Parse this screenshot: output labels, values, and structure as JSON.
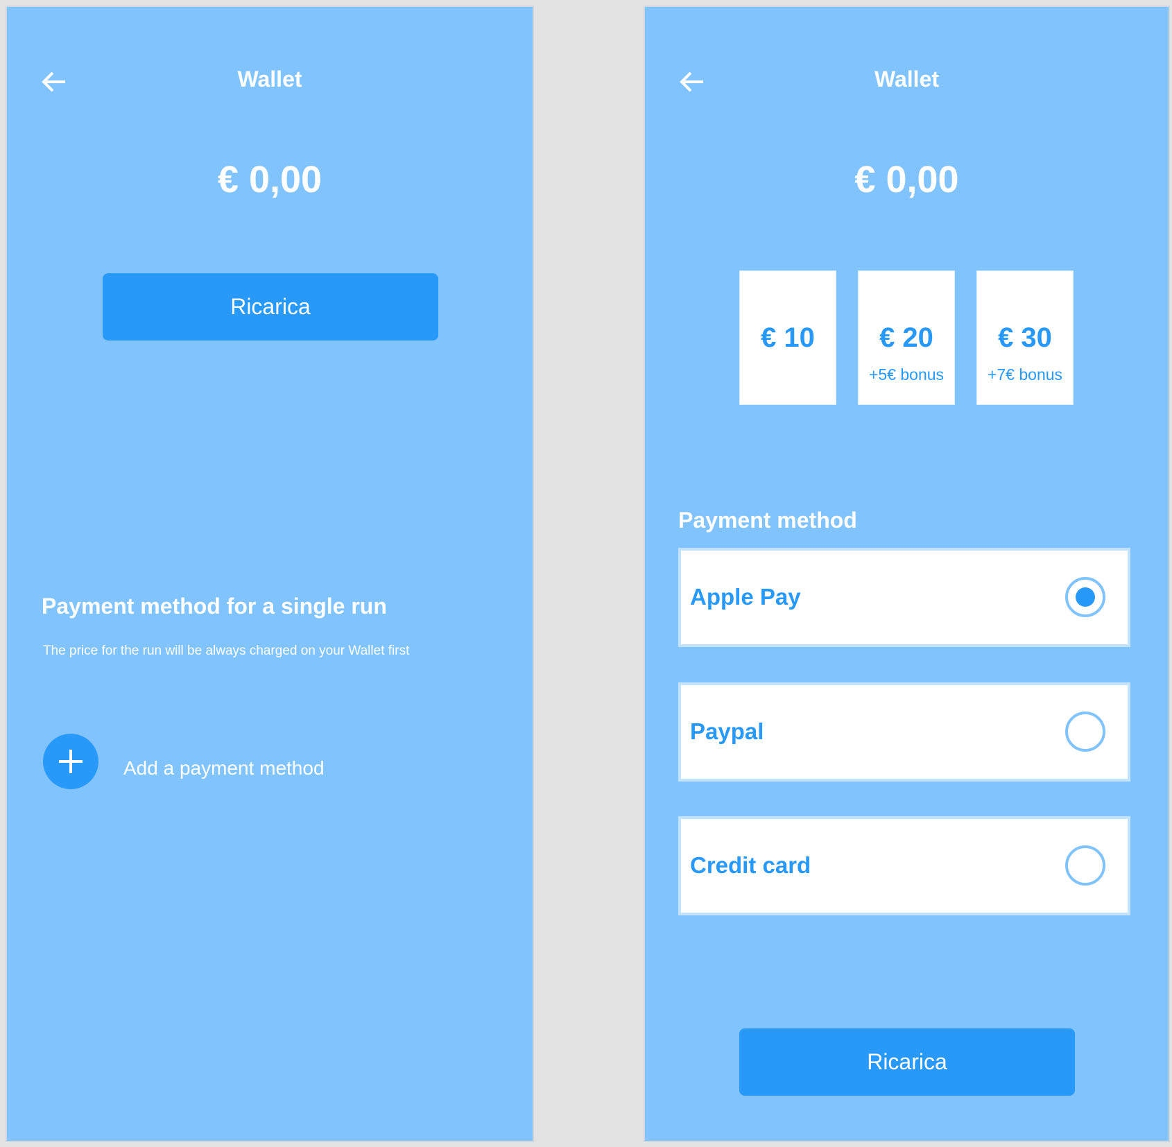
{
  "colors": {
    "background": "#80c3fd",
    "accent": "#2899f9",
    "text_on_bg": "#ffffff"
  },
  "left_screen": {
    "header": {
      "back_icon": "arrow-left-icon",
      "title": "Wallet"
    },
    "balance": "€ 0,00",
    "recharge_button": "Ricarica",
    "single_run": {
      "title": "Payment method for a single run",
      "description": "The price for the run will be always charged on your Wallet first",
      "add_icon": "plus-icon",
      "add_label": "Add a payment method"
    }
  },
  "right_screen": {
    "header": {
      "back_icon": "arrow-left-icon",
      "title": "Wallet"
    },
    "balance": "€ 0,00",
    "amounts": [
      {
        "value": "€ 10",
        "bonus": ""
      },
      {
        "value": "€ 20",
        "bonus": "+5€ bonus"
      },
      {
        "value": "€ 30",
        "bonus": "+7€ bonus"
      }
    ],
    "payment_method_title": "Payment method",
    "methods": [
      {
        "name": "Apple Pay",
        "selected": true
      },
      {
        "name": "Paypal",
        "selected": false
      },
      {
        "name": "Credit card",
        "selected": false
      }
    ],
    "recharge_button": "Ricarica"
  }
}
